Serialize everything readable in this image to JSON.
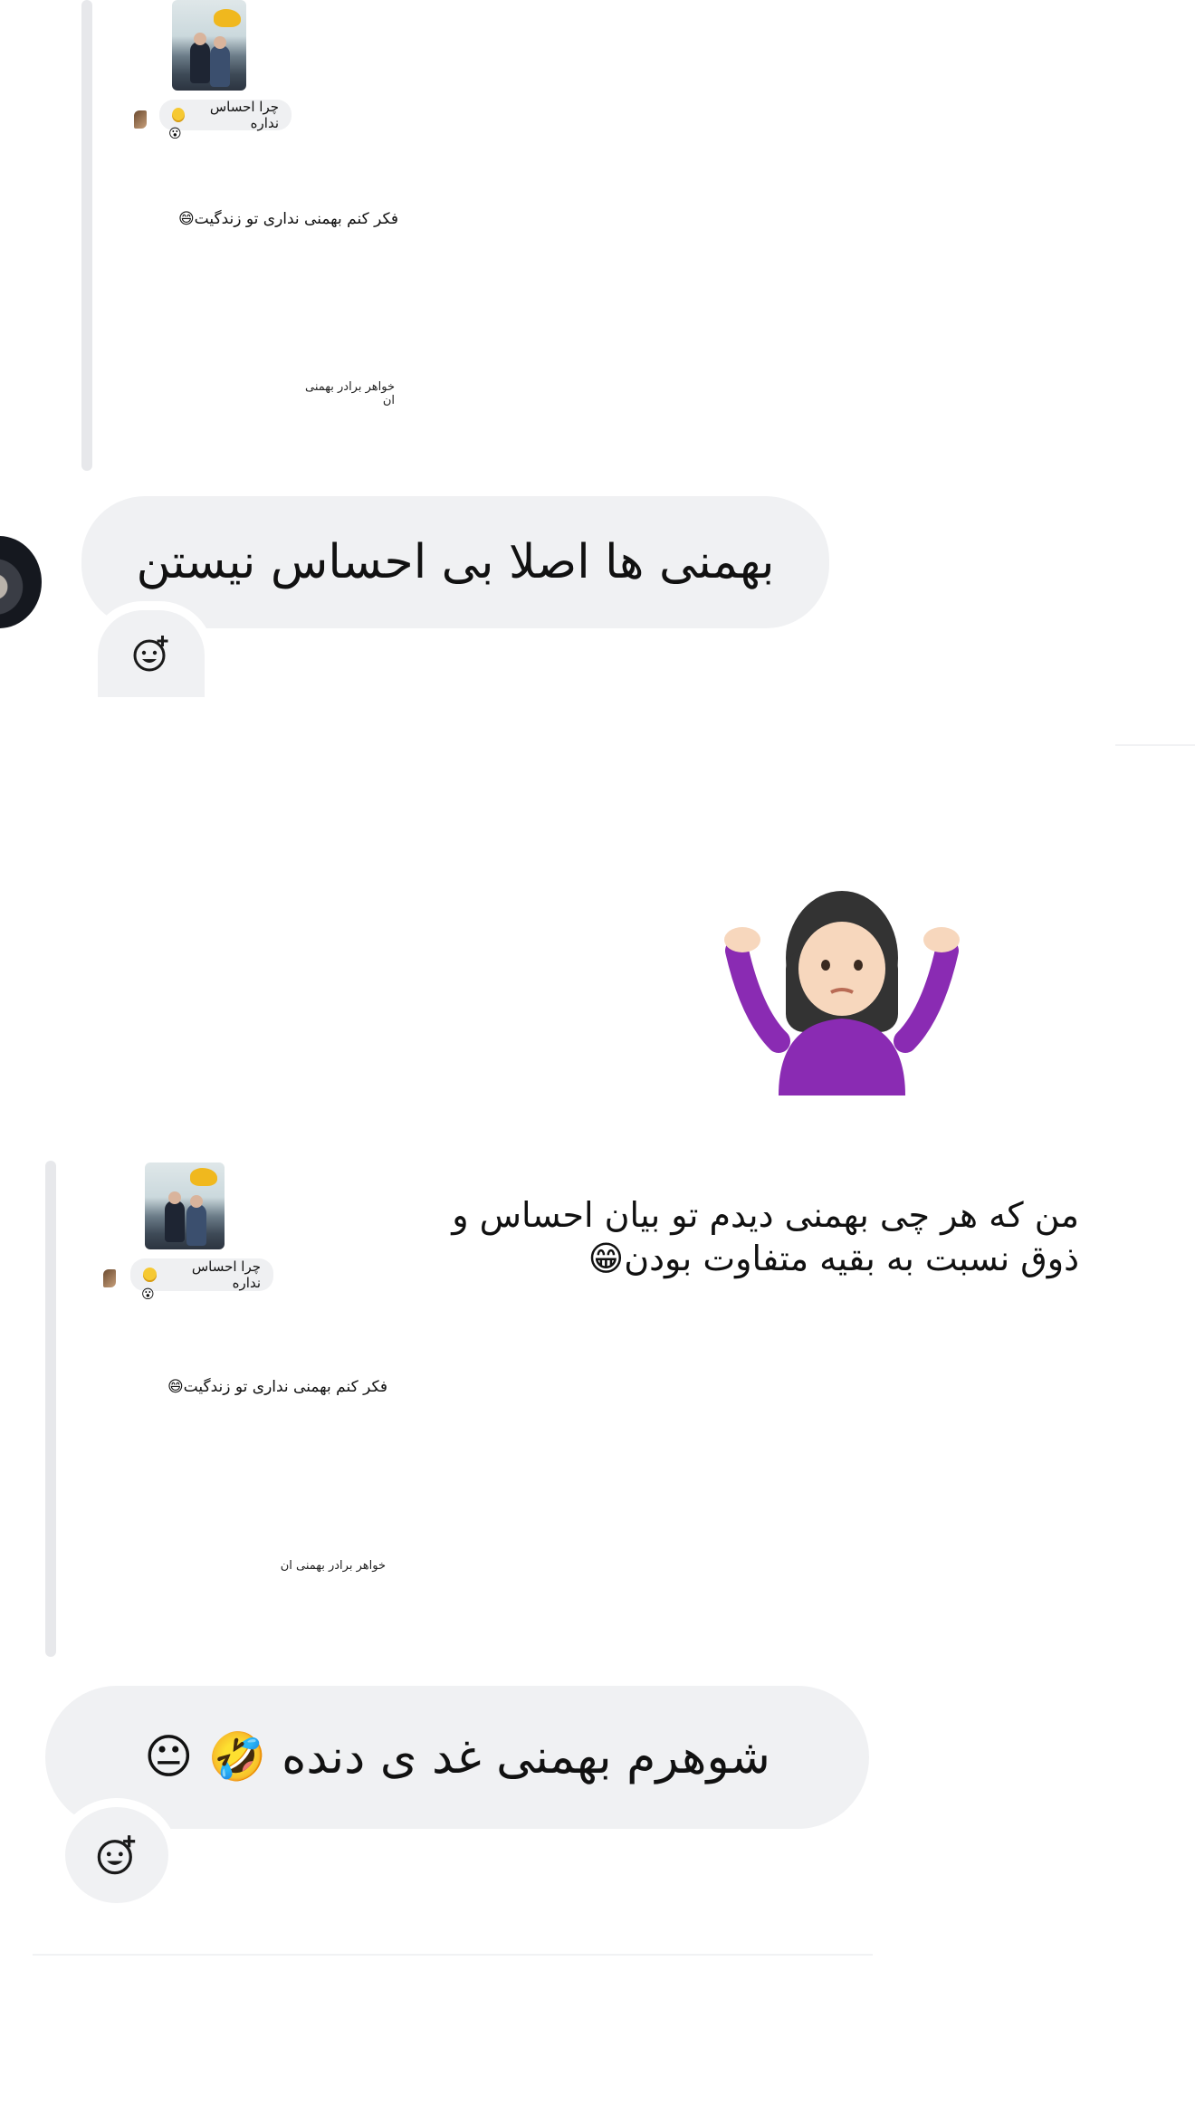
{
  "top_thread": {
    "reply_bubble": {
      "text": "چرا احساس نداره",
      "sub": "😮"
    },
    "line1": "فکر کنم بهمنی نداری تو زندگیت😄",
    "line2": "خواهر برادر بهمنی ان"
  },
  "comment1": {
    "text": "بهمنی ها اصلا بی احساس نیستن"
  },
  "emoji_post": {
    "emoji": "🤷🏻‍♀️"
  },
  "main_post": {
    "text": "من که هر چی بهمنی دیدم تو بیان احساس و ذوق نسبت به بقیه متفاوت بودن😁"
  },
  "second_thread": {
    "reply_bubble": {
      "text": "چرا احساس نداره",
      "sub": "😮"
    },
    "line1": "فکر کنم بهمنی نداری تو زندگیت😄",
    "line2": "خواهر برادر بهمنی ان"
  },
  "comment2": {
    "text": "شوهرم بهمنی غد ی دنده 🤣 😐"
  },
  "icons": {
    "react": "add-reaction-icon"
  },
  "colors": {
    "bubble": "#f0f1f3",
    "quote_line": "#e7e8eb",
    "page": "#ffffff"
  }
}
